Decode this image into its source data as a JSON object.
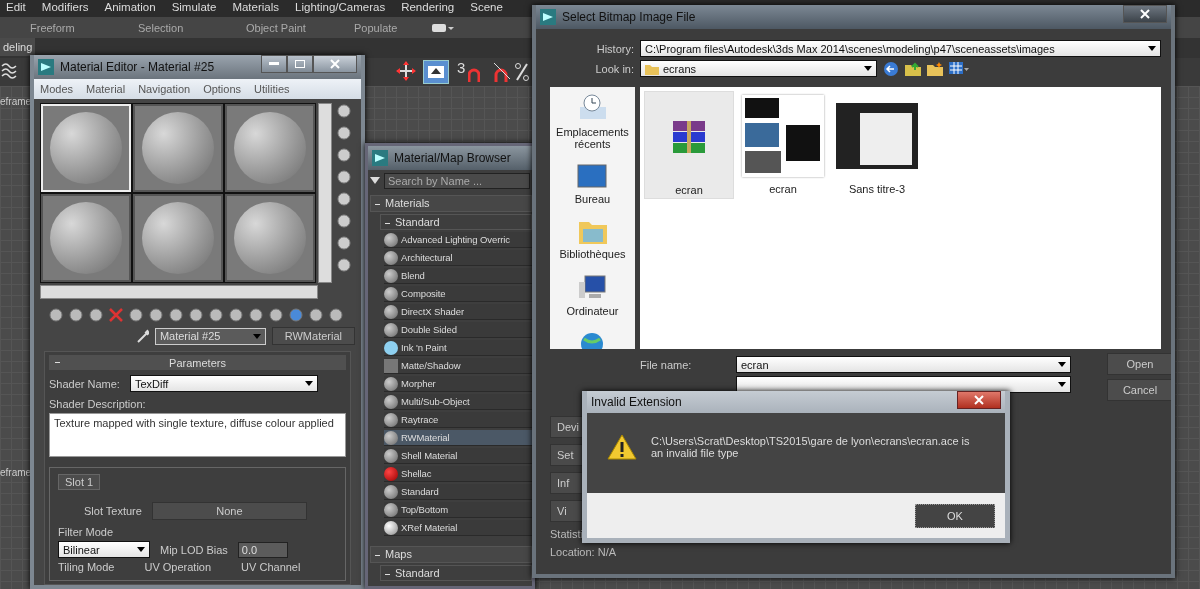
{
  "menu_bar": [
    "Edit",
    "Modifiers",
    "Animation",
    "Simulate",
    "Materials",
    "Lighting/Cameras",
    "Rendering",
    "Scene"
  ],
  "ribbon_tabs": [
    "Freeform",
    "Selection",
    "Object Paint",
    "Populate"
  ],
  "ribbon_panel_label": "deling",
  "snap_label": "3",
  "viewport_labels": [
    "eframe",
    "eframe"
  ],
  "material_editor": {
    "title": "Material Editor - Material #25",
    "menus": [
      "Modes",
      "Material",
      "Navigation",
      "Options",
      "Utilities"
    ],
    "slots": [
      {
        "selected": true
      },
      {
        "selected": false
      },
      {
        "selected": false
      },
      {
        "selected": false
      },
      {
        "selected": false
      },
      {
        "selected": false
      }
    ],
    "material_name": "Material #25",
    "material_type": "RWMaterial",
    "rollout_title": "Parameters",
    "shader_name_label": "Shader Name:",
    "shader_name": "TexDiff",
    "shader_description_label": "Shader Description:",
    "shader_description": "Texture mapped with single texture, diffuse colour applied",
    "slot_tab": "Slot 1",
    "slot_texture_label": "Slot Texture",
    "slot_texture": "None",
    "filter_mode_label": "Filter Mode",
    "filter_mode": "Bilinear",
    "mip_lod_bias_label": "Mip LOD Bias",
    "mip_lod_bias": "0.0",
    "tiling_mode_label": "Tiling Mode",
    "uv_operation_label": "UV Operation",
    "uv_channel_label": "UV Channel"
  },
  "browser": {
    "title": "Material/Map Browser",
    "search_placeholder": "Search by Name ...",
    "group": "Materials",
    "subgroup": "Standard",
    "items": [
      {
        "label": "Advanced Lighting Overric",
        "kind": "sphere",
        "selected": false
      },
      {
        "label": "Architectural",
        "kind": "sphere",
        "selected": false
      },
      {
        "label": "Blend",
        "kind": "sphere",
        "selected": false
      },
      {
        "label": "Composite",
        "kind": "sphere",
        "selected": false
      },
      {
        "label": "DirectX Shader",
        "kind": "sphere",
        "selected": false
      },
      {
        "label": "Double Sided",
        "kind": "sphere",
        "selected": false
      },
      {
        "label": "Ink 'n Paint",
        "kind": "toon",
        "selected": false
      },
      {
        "label": "Matte/Shadow",
        "kind": "flat",
        "selected": false
      },
      {
        "label": "Morpher",
        "kind": "sphere",
        "selected": false
      },
      {
        "label": "Multi/Sub-Object",
        "kind": "sphere",
        "selected": false
      },
      {
        "label": "Raytrace",
        "kind": "sphere",
        "selected": false
      },
      {
        "label": "RWMaterial",
        "kind": "sphere",
        "selected": true
      },
      {
        "label": "Shell Material",
        "kind": "sphere",
        "selected": false
      },
      {
        "label": "Shellac",
        "kind": "lacquer",
        "selected": false
      },
      {
        "label": "Standard",
        "kind": "sphere",
        "selected": false
      },
      {
        "label": "Top/Bottom",
        "kind": "sphere",
        "selected": false
      },
      {
        "label": "XRef Material",
        "kind": "xref",
        "selected": false
      }
    ],
    "group_2": "Maps",
    "subgroup_2": "Standard"
  },
  "file_dialog": {
    "title": "Select Bitmap Image File",
    "history_label": "History:",
    "history": "C:\\Program files\\Autodesk\\3ds Max 2014\\scenes\\modeling\\p47\\sceneassets\\images",
    "look_in_label": "Look in:",
    "look_in": "ecrans",
    "places": [
      {
        "label": "Emplacements récents",
        "kind": "recent"
      },
      {
        "label": "Bureau",
        "kind": "desktop"
      },
      {
        "label": "Bibliothèques",
        "kind": "libraries"
      },
      {
        "label": "Ordinateur",
        "kind": "computer"
      }
    ],
    "files": [
      {
        "name": "ecran",
        "kind": "archive",
        "selected": true
      },
      {
        "name": "ecran",
        "kind": "collage",
        "selected": false
      },
      {
        "name": "Sans titre-3",
        "kind": "screenshot",
        "selected": false
      }
    ],
    "file_name_label": "File name:",
    "file_name": "ecran",
    "open": "Open",
    "cancel": "Cancel",
    "side_buttons": [
      "Devi",
      "Set",
      "Inf",
      "Vi"
    ],
    "statistics_label": "Statisti",
    "location": "Location:  N/A"
  },
  "alert": {
    "title": "Invalid Extension",
    "message": "C:\\Users\\Scrat\\Desktop\\TS2015\\gare de lyon\\ecrans\\ecran.ace is an invalid file type",
    "ok": "OK"
  }
}
